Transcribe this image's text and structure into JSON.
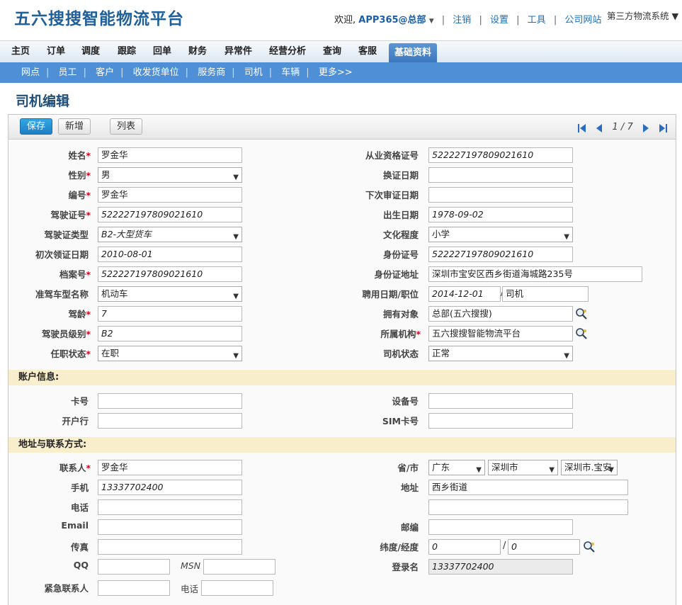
{
  "app": {
    "logo": "五六搜搜智能物流平台",
    "welcome": "欢迎,",
    "user": "APP365@总部",
    "links": [
      "注销",
      "设置",
      "工具",
      "公司网站"
    ],
    "system": "第三方物流系统"
  },
  "main_nav": [
    "主页",
    "订单",
    "调度",
    "跟踪",
    "回单",
    "财务",
    "异常件",
    "经营分析",
    "查询",
    "客服",
    "基础资料"
  ],
  "active_main_nav": "基础资料",
  "sub_nav": [
    "网点",
    "员工",
    "客户",
    "收发货单位",
    "服务商",
    "司机",
    "车辆",
    "更多>>"
  ],
  "page_title": "司机编辑",
  "toolbar": {
    "save": "保存",
    "add": "新增",
    "list": "列表",
    "page": "1 / 7"
  },
  "basic": {
    "name": {
      "label": "姓名",
      "value": "罗金华"
    },
    "gender": {
      "label": "性别",
      "value": "男"
    },
    "code": {
      "label": "编号",
      "value": "罗金华"
    },
    "license_no": {
      "label": "驾驶证号",
      "value": "522227197809021610"
    },
    "license_type": {
      "label": "驾驶证类型",
      "value": "B2-大型货车"
    },
    "first_issue": {
      "label": "初次领证日期",
      "value": "2010-08-01"
    },
    "file_no": {
      "label": "档案号",
      "value": "522227197809021610"
    },
    "vehicle_model": {
      "label": "准驾车型名称",
      "value": "机动车"
    },
    "driving_age": {
      "label": "驾龄",
      "value": "7"
    },
    "driver_level": {
      "label": "驾驶员级别",
      "value": "B2"
    },
    "employment_status": {
      "label": "任职状态",
      "value": "在职"
    },
    "qualification_no": {
      "label": "从业资格证号",
      "value": "522227197809021610"
    },
    "renewal_date": {
      "label": "换证日期",
      "value": ""
    },
    "next_review": {
      "label": "下次审证日期",
      "value": ""
    },
    "birth_date": {
      "label": "出生日期",
      "value": "1978-09-02"
    },
    "education": {
      "label": "文化程度",
      "value": "小学"
    },
    "id_no": {
      "label": "身份证号",
      "value": "522227197809021610"
    },
    "id_address": {
      "label": "身份证地址",
      "value": "深圳市宝安区西乡街道海城路235号"
    },
    "hire": {
      "label": "聘用日期/职位",
      "date": "2014-12-01",
      "position": "司机"
    },
    "owner": {
      "label": "拥有对象",
      "value": "总部(五六搜搜)"
    },
    "org": {
      "label": "所属机构",
      "value": "五六搜搜智能物流平台"
    },
    "driver_status": {
      "label": "司机状态",
      "value": "正常"
    }
  },
  "account": {
    "title": "账户信息:",
    "card_no": {
      "label": "卡号",
      "value": ""
    },
    "bank": {
      "label": "开户行",
      "value": ""
    },
    "device_no": {
      "label": "设备号",
      "value": ""
    },
    "sim_no": {
      "label": "SIM卡号",
      "value": ""
    }
  },
  "contact": {
    "title": "地址与联系方式:",
    "contact_person": {
      "label": "联系人",
      "value": "罗金华"
    },
    "mobile": {
      "label": "手机",
      "value": "13337702400"
    },
    "phone": {
      "label": "电话",
      "value": ""
    },
    "email": {
      "label": "Email",
      "value": ""
    },
    "fax": {
      "label": "传真",
      "value": ""
    },
    "qq": {
      "label": "QQ",
      "value": ""
    },
    "msn": {
      "label": "MSN",
      "value": ""
    },
    "emergency": {
      "label": "紧急联系人",
      "value": "",
      "phone_label": "电话",
      "phone": ""
    },
    "province_city": {
      "label": "省/市",
      "province": "广东",
      "city": "深圳市",
      "district": "深圳市.宝安"
    },
    "address": {
      "label": "地址",
      "value": "西乡街道",
      "value2": ""
    },
    "postcode": {
      "label": "邮编",
      "value": ""
    },
    "latlng": {
      "label": "纬度/经度",
      "lat": "0",
      "lng": "0"
    },
    "login": {
      "label": "登录名",
      "value": "13337702400"
    }
  }
}
